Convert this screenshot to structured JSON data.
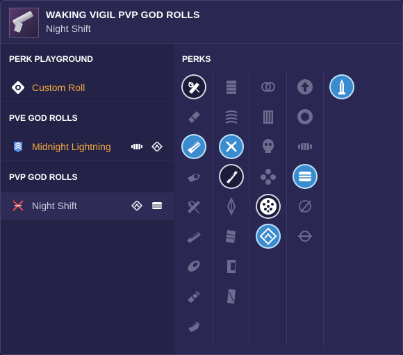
{
  "header": {
    "title": "WAKING VIGIL PVP GOD ROLLS",
    "subtitle": "Night Shift"
  },
  "left_panel": {
    "perk_playground": {
      "heading": "PERK PLAYGROUND",
      "items": [
        {
          "label": "Custom Roll",
          "icon": "target-icon"
        }
      ]
    },
    "pve_god_rolls": {
      "heading": "PVE GOD ROLLS",
      "items": [
        {
          "label": "Midnight Lightning",
          "icon": "chevron-rank-icon"
        }
      ]
    },
    "pvp_god_rolls": {
      "heading": "PVP GOD ROLLS",
      "items": [
        {
          "label": "Night Shift",
          "icon": "crossed-swords-icon"
        }
      ]
    }
  },
  "perks_panel": {
    "heading": "PERKS",
    "columns": [
      {
        "perks": [
          "barrel-selected",
          "barrel",
          "barrel-selected",
          "barrel",
          "barrel",
          "barrel",
          "barrel",
          "barrel",
          "barrel"
        ]
      },
      {
        "perks": [
          "magazine",
          "magazine",
          "magazine-selected",
          "magazine-selected-dark",
          "magazine",
          "magazine",
          "magazine",
          "magazine"
        ]
      },
      {
        "perks": [
          "trait",
          "trait",
          "trait",
          "trait",
          "trait-selected-dark",
          "trait-selected"
        ]
      },
      {
        "perks": [
          "trait",
          "trait",
          "trait",
          "trait-selected",
          "trait",
          "trait"
        ]
      },
      {
        "perks": [
          "masterwork-selected"
        ]
      }
    ]
  },
  "colors": {
    "accent_orange": "#f1a93a",
    "selected_blue": "#3a8ccf",
    "background": "#26234a"
  }
}
